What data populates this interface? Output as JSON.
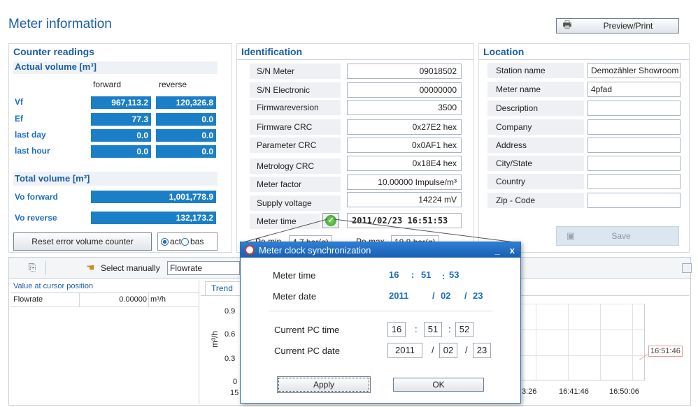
{
  "header": {
    "title": "Meter information",
    "preview_label": "Preview/Print"
  },
  "counter": {
    "title": "Counter readings",
    "actual_title": "Actual volume [m³]",
    "col_forward": "forward",
    "col_reverse": "reverse",
    "rows": [
      {
        "label": "Vf",
        "forward": "967,113.2",
        "reverse": "120,326.8"
      },
      {
        "label": "Ef",
        "forward": "77.3",
        "reverse": "0.0"
      },
      {
        "label": "last day",
        "forward": "0.0",
        "reverse": "0.0"
      },
      {
        "label": "last hour",
        "forward": "0.0",
        "reverse": "0.0"
      }
    ],
    "total_title": "Total volume [m³]",
    "totals": [
      {
        "label": "Vo forward",
        "value": "1,001,778.9"
      },
      {
        "label": "Vo reverse",
        "value": "132,173.2"
      }
    ],
    "reset_label": "Reset error volume counter",
    "radio_act": "act",
    "radio_bas": "bas"
  },
  "identification": {
    "title": "Identification",
    "rows": [
      {
        "label": "S/N Meter",
        "value": "09018502"
      },
      {
        "label": "S/N Electronic",
        "value": "00000000"
      },
      {
        "label": "Firmwareversion",
        "value": "3500"
      },
      {
        "label": "Firmware CRC",
        "value": "0x27E2 hex"
      },
      {
        "label": "Parameter CRC",
        "value": "0x0AF1 hex"
      },
      {
        "label": "Metrology CRC",
        "value": "0x18E4 hex"
      },
      {
        "label": "Meter factor",
        "value": "10.00000 Impulse/m³"
      },
      {
        "label": "Supply voltage",
        "value": "14224 mV"
      }
    ],
    "meter_time_label": "Meter time",
    "meter_time_value": "2011/02/23  16:51:53",
    "pe_min_label": "Pe min",
    "pe_min_value": "4.7 bar(g)",
    "pe_max_label": "Pe max",
    "pe_max_value": "18.8 bar(g)"
  },
  "location": {
    "title": "Location",
    "rows": [
      {
        "label": "Station name",
        "value": "Demozähler Showroom"
      },
      {
        "label": "Meter name",
        "value": "4pfad"
      },
      {
        "label": "Description",
        "value": ""
      },
      {
        "label": "Company",
        "value": ""
      },
      {
        "label": "Address",
        "value": ""
      },
      {
        "label": "City/State",
        "value": ""
      },
      {
        "label": "Country",
        "value": ""
      },
      {
        "label": "Zip - Code",
        "value": ""
      }
    ],
    "save_label": "Save"
  },
  "trend_toolbar": {
    "select_label": "Select manually",
    "select_value": "Flowrate"
  },
  "cursor_panel": {
    "title": "Value at cursor position",
    "rows": [
      {
        "name": "Flowrate",
        "value": "0.00000",
        "unit": "m³/h"
      }
    ]
  },
  "trend": {
    "tab_label": "Trend",
    "ylabel": "m³/h",
    "yticks": [
      "0.9",
      "0.6",
      "0.3",
      "0"
    ],
    "xtick_left": "15",
    "xticks_right": [
      "3:26",
      "16:41:46",
      "16:50:06"
    ],
    "cursor_label": "16:51:46"
  },
  "dialog": {
    "title": "Meter clock synchronization",
    "meter_time_label": "Meter time",
    "meter_time": {
      "h": "16",
      "m": "51",
      "s": "53"
    },
    "meter_date_label": "Meter date",
    "meter_date": {
      "y": "2011",
      "mo": "02",
      "d": "23"
    },
    "pc_time_label": "Current PC time",
    "pc_time": {
      "h": "16",
      "m": "51",
      "s": "52"
    },
    "pc_date_label": "Current PC date",
    "pc_date": {
      "y": "2011",
      "mo": "02",
      "d": "23"
    },
    "sep_time": ":",
    "sep_date": "/",
    "apply_label": "Apply",
    "ok_label": "OK",
    "min_label": "_",
    "close_label": "x"
  }
}
